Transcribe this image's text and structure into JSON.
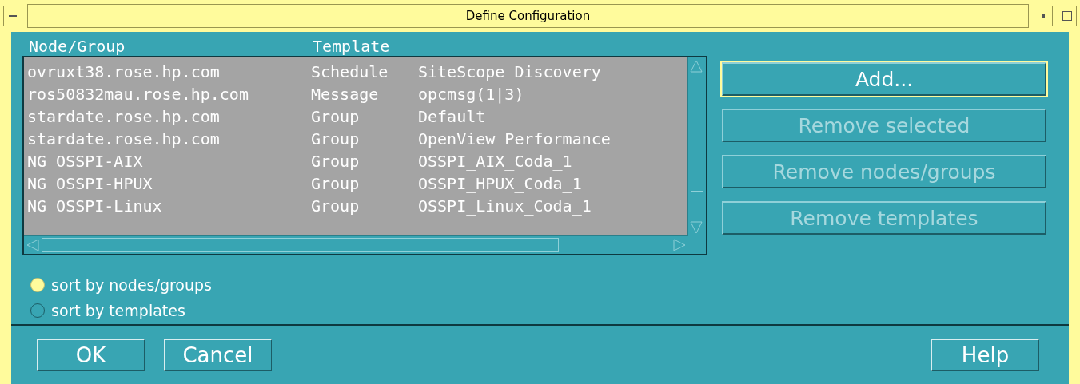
{
  "window": {
    "title": "Define Configuration"
  },
  "list": {
    "columns": [
      "Node/Group",
      "Template"
    ],
    "rows": [
      {
        "node": "ovruxt38.rose.hp.com",
        "type": "Schedule",
        "template": "SiteScope_Discovery"
      },
      {
        "node": "ros50832mau.rose.hp.com",
        "type": "Message",
        "template": "opcmsg(1|3)"
      },
      {
        "node": "stardate.rose.hp.com",
        "type": "Group",
        "template": "Default"
      },
      {
        "node": "stardate.rose.hp.com",
        "type": "Group",
        "template": "OpenView Performance"
      },
      {
        "node": "NG OSSPI-AIX",
        "type": "Group",
        "template": "OSSPI_AIX_Coda_1"
      },
      {
        "node": "NG OSSPI-HPUX",
        "type": "Group",
        "template": "OSSPI_HPUX_Coda_1"
      },
      {
        "node": "NG OSSPI-Linux",
        "type": "Group",
        "template": "OSSPI_Linux_Coda_1"
      }
    ]
  },
  "side_buttons": [
    {
      "label": "Add...",
      "disabled": false
    },
    {
      "label": "Remove selected",
      "disabled": true
    },
    {
      "label": "Remove nodes/groups",
      "disabled": true
    },
    {
      "label": "Remove templates",
      "disabled": true
    }
  ],
  "sort_options": [
    {
      "label": "sort by nodes/groups",
      "selected": true
    },
    {
      "label": "sort by templates",
      "selected": false
    }
  ],
  "footer_left_buttons": [
    "OK",
    "Cancel"
  ],
  "footer_right_buttons": [
    "Help"
  ]
}
